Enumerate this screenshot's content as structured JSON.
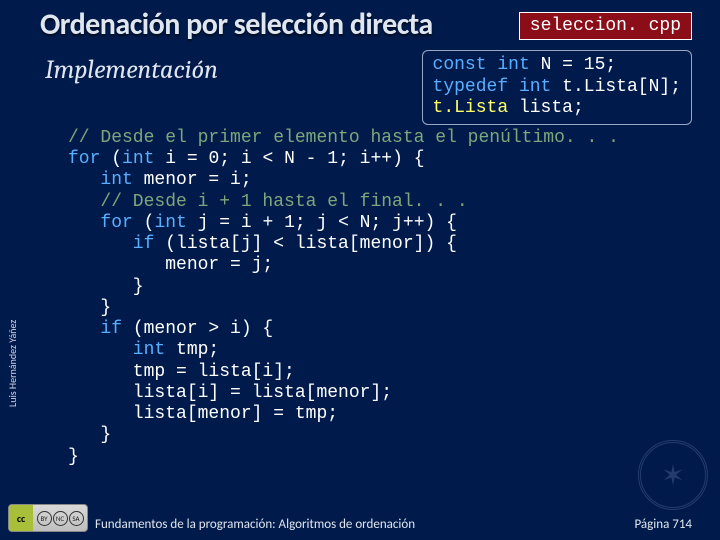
{
  "title": "Ordenación por selección directa",
  "file_pill": "seleccion. cpp",
  "subtitle": "Implementación",
  "decl": {
    "l1_kw1": "const ",
    "l1_kw2": "int ",
    "l1_id": "N = 15;",
    "l2_kw1": "typedef ",
    "l2_kw2": "int ",
    "l2_id": "t.Lista[N];",
    "l3_hl": "t.Lista ",
    "l3_id": "lista;"
  },
  "code": {
    "l1_cmt": "// Desde el primer elemento hasta el penúltimo. . .",
    "l2_kw": "for ",
    "l2_a": "(",
    "l2_kwint": "int ",
    "l2_b": "i = 0; i < N - 1; i++) {",
    "l3_kw": "   int ",
    "l3_a": "menor = i;",
    "l4_cmt": "   // Desde i + 1 hasta el final. . .",
    "l5_kw": "   for ",
    "l5_a": "(",
    "l5_kwint": "int ",
    "l5_b": "j = i + 1; j < N; j++) {",
    "l6_kw": "      if ",
    "l6_a": "(lista[j] < lista[menor]) {",
    "l7": "         menor = j;",
    "l8": "      }",
    "l9": "   }",
    "l10_kw": "   if ",
    "l10_a": "(menor > i) {",
    "l11_kw": "      int ",
    "l11_a": "tmp;",
    "l12": "      tmp = lista[i];",
    "l13": "      lista[i] = lista[menor];",
    "l14": "      lista[menor] = tmp;",
    "l15": "   }",
    "l16": "}"
  },
  "author": "Luis Hernández Yáñez",
  "footer_text": "Fundamentos de la programación: Algoritmos de ordenación",
  "footer_page": "Página 714",
  "cc": {
    "left": "cc",
    "a": "BY",
    "b": "NC",
    "c": "SA"
  }
}
